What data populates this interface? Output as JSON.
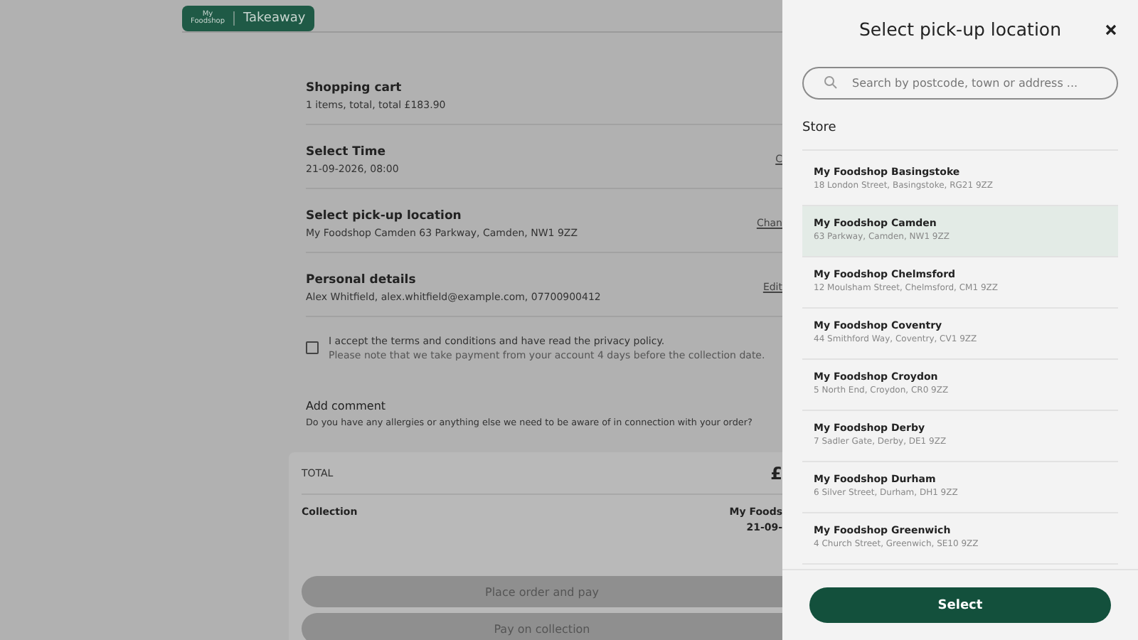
{
  "header": {
    "logo": {
      "line_1": "My",
      "line_2": "Foodshop"
    },
    "title": "Takeaway"
  },
  "sections": [
    {
      "title": "Shopping cart",
      "detail": "1 items, total, total £183.90"
    },
    {
      "title": "Select Time",
      "detail": "21-09-2026, 08:00",
      "action": "C"
    },
    {
      "title": "Select pick-up location",
      "detail": "My Foodshop Camden 63 Parkway, Camden, NW1 9ZZ",
      "action": "Chan"
    },
    {
      "title": "Personal details",
      "detail": "Alex Whitfield, alex.whitfield@example.com, 07700900412",
      "action": "Edit"
    }
  ],
  "terms": {
    "checked": false,
    "label": "I accept the terms and conditions and have read the privacy policy.",
    "note": "Please note that we take payment from your account 4 days before the collection date."
  },
  "comment": {
    "title": "Add comment",
    "hint": "Do you have any allergies or anything else we need to be aware of in connection with your order?"
  },
  "summary": {
    "total_label": "TOTAL",
    "total_value": "£",
    "collection_label": "Collection",
    "collection_store": "My Foods",
    "collection_date": "21-09-",
    "buttons": [
      "Place order and pay",
      "Pay on collection"
    ]
  },
  "drawer": {
    "title": "Select pick-up location",
    "search": {
      "placeholder": "Search by postcode, town or address ..."
    },
    "group": "Store",
    "stores": [
      {
        "name": "My Foodshop Basingstoke",
        "address": "18 London Street, Basingstoke, RG21 9ZZ",
        "selected": false
      },
      {
        "name": "My Foodshop Camden",
        "address": "63 Parkway, Camden, NW1 9ZZ",
        "selected": true
      },
      {
        "name": "My Foodshop Chelmsford",
        "address": "12 Moulsham Street, Chelmsford, CM1 9ZZ",
        "selected": false
      },
      {
        "name": "My Foodshop Coventry",
        "address": "44 Smithford Way, Coventry, CV1 9ZZ",
        "selected": false
      },
      {
        "name": "My Foodshop Croydon",
        "address": "5 North End, Croydon, CR0 9ZZ",
        "selected": false
      },
      {
        "name": "My Foodshop Derby",
        "address": "7 Sadler Gate, Derby, DE1 9ZZ",
        "selected": false
      },
      {
        "name": "My Foodshop Durham",
        "address": "6 Silver Street, Durham, DH1 9ZZ",
        "selected": false
      },
      {
        "name": "My Foodshop Greenwich",
        "address": "4 Church Street, Greenwich, SE10 9ZZ",
        "selected": false
      }
    ],
    "button": "Select"
  }
}
